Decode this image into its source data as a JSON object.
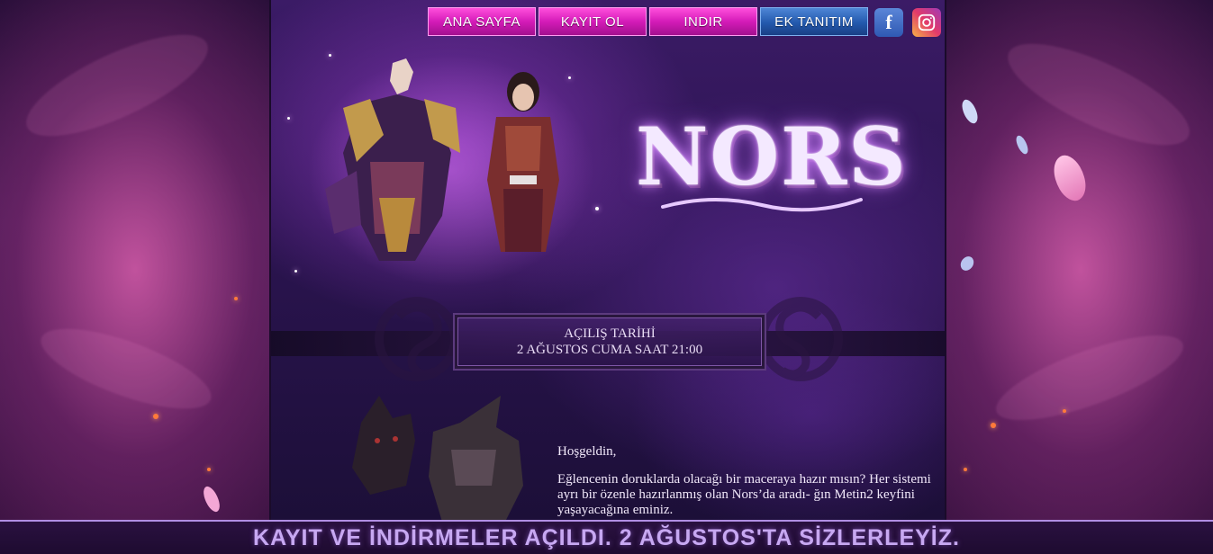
{
  "nav": {
    "items": [
      {
        "label": "ANA SAYFA"
      },
      {
        "label": "KAYIT OL"
      },
      {
        "label": "INDIR"
      },
      {
        "label": "EK TANITIM"
      }
    ]
  },
  "social": {
    "facebook_icon": "facebook-icon",
    "instagram_icon": "instagram-icon"
  },
  "logo": {
    "text": "NORS"
  },
  "opening": {
    "title": "AÇILIŞ TARİHİ",
    "date": "2 AĞUSTOS CUMA SAAT 21:00"
  },
  "welcome": {
    "greeting": "Hoşgeldin,",
    "body": "Eğlencenin doruklarda olacağı bir maceraya hazır mısın? Her sistemi ayrı bir özenle hazırlanmış olan Nors’da aradı- ğın Metin2 keyfini yaşayacağına eminiz."
  },
  "footer": {
    "announcement": "KAYIT VE İNDİRMELER AÇILDI. 2 AĞUSTOS'TA SİZLERLEYİZ."
  },
  "colors": {
    "nav_pink": "#d41bb8",
    "nav_blue": "#2359ad",
    "footer_text": "#c7a8f2",
    "footer_border": "#b18ee4"
  }
}
